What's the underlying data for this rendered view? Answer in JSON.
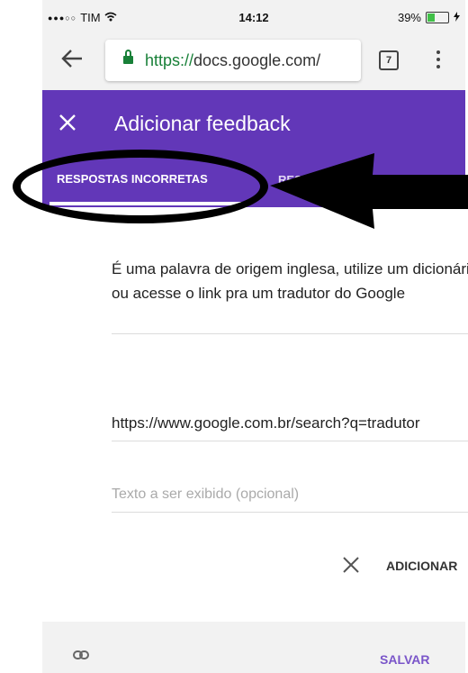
{
  "status_bar": {
    "carrier": "TIM",
    "time": "14:12",
    "battery": "39%",
    "battery_level": 0.39,
    "signal_icon": "signal-dots-icon",
    "wifi_icon": "wifi-icon",
    "charging_icon": "charging-icon"
  },
  "browser": {
    "url_scheme": "https://",
    "url_host": "docs.google.com/",
    "tab_count": "7"
  },
  "dialog": {
    "title": "Adicionar feedback",
    "tabs": [
      {
        "label": "RESPOSTAS INCORRETAS"
      },
      {
        "label": "RESPOSTAS CORRETAS"
      }
    ],
    "feedback_text": "É uma palavra de origem inglesa, utilize um dicionário, ou acesse o link pra um tradutor do Google",
    "link_value": "https://www.google.com.br/search?q=tradutor",
    "display_text_placeholder": "Texto a ser exibido (opcional)",
    "add_label": "ADICIONAR",
    "save_label": "SALVAR"
  },
  "colors": {
    "header": "#6237b8",
    "accent": "#7a55c9",
    "annotation": "#000000"
  }
}
